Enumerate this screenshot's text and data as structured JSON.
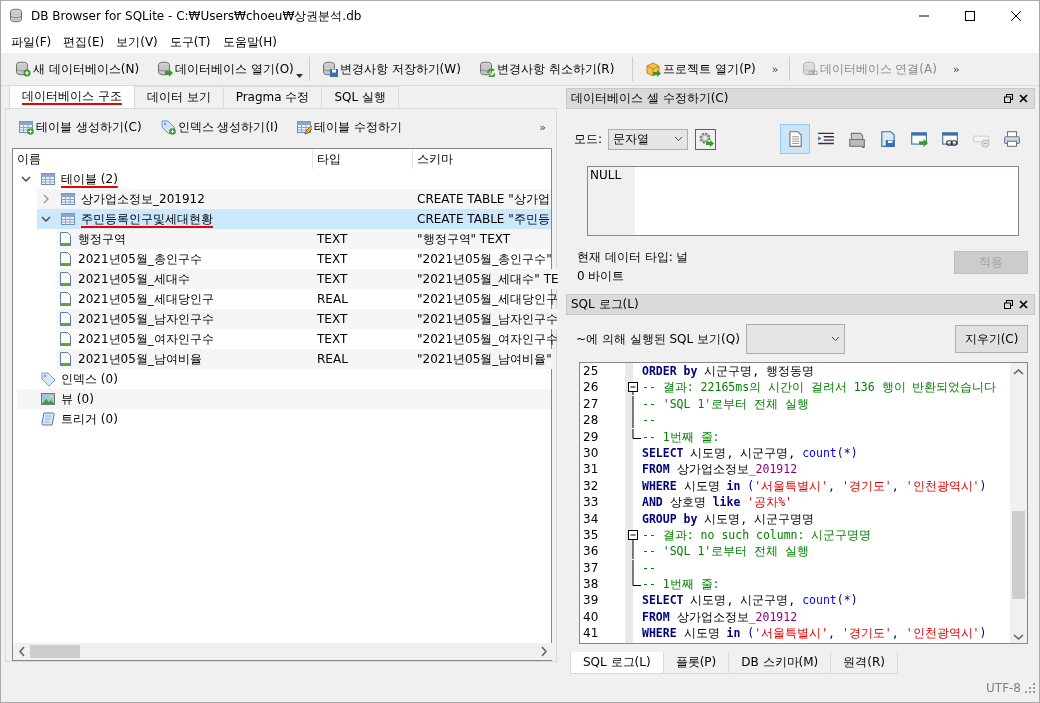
{
  "window": {
    "title": "DB Browser for SQLite - C:₩Users₩choeu₩상권분석.db"
  },
  "menu": [
    "파일(F)",
    "편집(E)",
    "보기(V)",
    "도구(T)",
    "도움말(H)"
  ],
  "toolbar": [
    {
      "kind": "button",
      "label": "새 데이터베이스(N)",
      "disabled": false
    },
    {
      "kind": "button",
      "label": "데이터베이스 열기(O)",
      "disabled": false,
      "dropdown": true
    },
    {
      "kind": "separator"
    },
    {
      "kind": "button",
      "label": "변경사항 저장하기(W)",
      "disabled": false
    },
    {
      "kind": "button",
      "label": "변경사항 취소하기(R)",
      "disabled": false
    },
    {
      "kind": "separator"
    },
    {
      "kind": "button",
      "label": "프로젝트 열기(P)",
      "disabled": false
    },
    {
      "kind": "overflow",
      "label": "»"
    },
    {
      "kind": "separator"
    },
    {
      "kind": "button",
      "label": "데이터베이스 연결(A)",
      "disabled": true
    },
    {
      "kind": "overflow",
      "label": "»"
    }
  ],
  "left_tabs": [
    {
      "label": "데이터베이스 구조",
      "selected": true,
      "underlined": true
    },
    {
      "label": "데이터 보기",
      "selected": false,
      "underlined": false
    },
    {
      "label": "Pragma 수정",
      "selected": false,
      "underlined": false
    },
    {
      "label": "SQL 실행",
      "selected": false,
      "underlined": false
    }
  ],
  "structure_toolbar": [
    {
      "kind": "button",
      "label": "테이블 생성하기(C)"
    },
    {
      "kind": "button",
      "label": "인덱스 생성하기(I)"
    },
    {
      "kind": "button",
      "label": "테이블 수정하기"
    },
    {
      "kind": "overflow",
      "label": "»"
    }
  ],
  "tree": {
    "columns": [
      "이름",
      "타입",
      "스키마"
    ],
    "items": [
      {
        "name": "테이블 (2)",
        "expanded": true,
        "selected": false,
        "underlined": true,
        "children": [
          {
            "name": "상가업소정보_201912",
            "schema": "CREATE TABLE \"상가업",
            "expanded": false,
            "selected": false,
            "underlined": false
          },
          {
            "name": "주민등록인구및세대현황",
            "schema": "CREATE TABLE \"주민등",
            "expanded": true,
            "selected": true,
            "underlined": true,
            "children": [
              {
                "name": "행정구역",
                "type": "TEXT",
                "schema": "\"행정구역\" TEXT",
                "selected": false,
                "underlined": false
              },
              {
                "name": "2021년05월_총인구수",
                "type": "TEXT",
                "schema": "\"2021년05월_총인구수\"",
                "selected": false,
                "underlined": false
              },
              {
                "name": "2021년05월_세대수",
                "type": "TEXT",
                "schema": "\"2021년05월_세대수\" TE",
                "selected": false,
                "underlined": false
              },
              {
                "name": "2021년05월_세대당인구",
                "type": "REAL",
                "schema": "\"2021년05월_세대당인구",
                "selected": false,
                "underlined": false
              },
              {
                "name": "2021년05월_남자인구수",
                "type": "TEXT",
                "schema": "\"2021년05월_남자인구수",
                "selected": false,
                "underlined": false
              },
              {
                "name": "2021년05월_여자인구수",
                "type": "TEXT",
                "schema": "\"2021년05월_여자인구수",
                "selected": false,
                "underlined": false
              },
              {
                "name": "2021년05월_남여비율",
                "type": "REAL",
                "schema": "\"2021년05월_남여비율\"",
                "selected": false,
                "underlined": false
              }
            ]
          }
        ]
      },
      {
        "name": "인덱스 (0)",
        "selected": false,
        "underlined": false
      },
      {
        "name": "뷰 (0)",
        "selected": false,
        "underlined": false
      },
      {
        "name": "트리거 (0)",
        "selected": false,
        "underlined": false
      }
    ]
  },
  "cell_editor": {
    "title": "데이터베이스 셀 수정하기(C)",
    "mode_label": "모드:",
    "mode": "문자열",
    "tools": [
      {
        "selected": true,
        "disabled": false
      },
      {
        "selected": false,
        "disabled": false
      },
      {
        "selected": false,
        "disabled": false
      },
      {
        "selected": false,
        "disabled": false
      },
      {
        "selected": false,
        "disabled": false
      },
      {
        "selected": false,
        "disabled": false
      },
      {
        "selected": false,
        "disabled": true
      },
      {
        "selected": false,
        "disabled": false
      }
    ],
    "value": "NULL",
    "type_info": "현재 데이터 타입: 널",
    "size": "0 바이트",
    "apply": {
      "label": "적용",
      "disabled": true
    }
  },
  "sql_log": {
    "title": "SQL 로그(L)",
    "filter_label": "~에 의해 실행된 SQL 보기(Q)",
    "clear": "지우기(C)",
    "lines": [
      {
        "no": "25",
        "kind": "code",
        "tokens": [
          {
            "kind": "kw",
            "text": "ORDER by"
          },
          {
            "kind": "plain",
            "text": " 시군구명, 행정동명"
          }
        ]
      },
      {
        "no": "26",
        "kind": "fold_start",
        "tokens": [
          {
            "kind": "cmt",
            "text": "-- 결과: 22165ms의 시간이 걸려서 136 행이 반환되었습니다"
          }
        ]
      },
      {
        "no": "27",
        "kind": "fold_body",
        "tokens": [
          {
            "kind": "cmt",
            "text": "-- 'SQL 1'로부터 전체 실행"
          }
        ]
      },
      {
        "no": "28",
        "kind": "fold_body",
        "tokens": [
          {
            "kind": "cmt",
            "text": "--"
          }
        ]
      },
      {
        "no": "29",
        "kind": "fold_end",
        "tokens": [
          {
            "kind": "cmt",
            "text": "-- 1번째 줄:"
          }
        ]
      },
      {
        "no": "30",
        "kind": "code",
        "tokens": [
          {
            "kind": "kw",
            "text": "SELECT"
          },
          {
            "kind": "plain",
            "text": " 시도명, 시군구명, "
          },
          {
            "kind": "fn",
            "text": "count"
          },
          {
            "kind": "op",
            "text": "(*)"
          }
        ]
      },
      {
        "no": "31",
        "kind": "code",
        "tokens": [
          {
            "kind": "kw",
            "text": "FROM"
          },
          {
            "kind": "plain",
            "text": " 상가업소정보"
          },
          {
            "kind": "num",
            "text": "_201912"
          }
        ]
      },
      {
        "no": "32",
        "kind": "code",
        "tokens": [
          {
            "kind": "kw",
            "text": "WHERE"
          },
          {
            "kind": "plain",
            "text": " 시도명 "
          },
          {
            "kind": "kw",
            "text": "in"
          },
          {
            "kind": "op",
            "text": " ("
          },
          {
            "kind": "str",
            "text": "'서울특별시'"
          },
          {
            "kind": "op",
            "text": ", "
          },
          {
            "kind": "str",
            "text": "'경기도'"
          },
          {
            "kind": "op",
            "text": ", "
          },
          {
            "kind": "str",
            "text": "'인천광역시'"
          },
          {
            "kind": "op",
            "text": ")"
          }
        ]
      },
      {
        "no": "33",
        "kind": "code",
        "tokens": [
          {
            "kind": "kw",
            "text": "AND"
          },
          {
            "kind": "plain",
            "text": " 상호명 "
          },
          {
            "kind": "kw",
            "text": "like "
          },
          {
            "kind": "str",
            "text": "'공차%'"
          }
        ]
      },
      {
        "no": "34",
        "kind": "code",
        "tokens": [
          {
            "kind": "kw",
            "text": "GROUP by"
          },
          {
            "kind": "plain",
            "text": " 시도명, 시군구명명"
          }
        ]
      },
      {
        "no": "35",
        "kind": "fold_start",
        "tokens": [
          {
            "kind": "cmt",
            "text": "-- 결과: no such column: 시군구명명"
          }
        ]
      },
      {
        "no": "36",
        "kind": "fold_body",
        "tokens": [
          {
            "kind": "cmt",
            "text": "-- 'SQL 1'로부터 전체 실행"
          }
        ]
      },
      {
        "no": "37",
        "kind": "fold_body",
        "tokens": [
          {
            "kind": "cmt",
            "text": "--"
          }
        ]
      },
      {
        "no": "38",
        "kind": "fold_end",
        "tokens": [
          {
            "kind": "cmt",
            "text": "-- 1번째 줄:"
          }
        ]
      },
      {
        "no": "39",
        "kind": "code",
        "tokens": [
          {
            "kind": "kw",
            "text": "SELECT"
          },
          {
            "kind": "plain",
            "text": " 시도명, 시군구명, "
          },
          {
            "kind": "fn",
            "text": "count"
          },
          {
            "kind": "op",
            "text": "(*)"
          }
        ]
      },
      {
        "no": "40",
        "kind": "code",
        "tokens": [
          {
            "kind": "kw",
            "text": "FROM"
          },
          {
            "kind": "plain",
            "text": " 상가업소정보"
          },
          {
            "kind": "num",
            "text": "_201912"
          }
        ]
      },
      {
        "no": "41",
        "kind": "code",
        "tokens": [
          {
            "kind": "kw",
            "text": "WHERE"
          },
          {
            "kind": "plain",
            "text": " 시도명 "
          },
          {
            "kind": "kw",
            "text": "in"
          },
          {
            "kind": "op",
            "text": " ("
          },
          {
            "kind": "str",
            "text": "'서울특별시'"
          },
          {
            "kind": "op",
            "text": ", "
          },
          {
            "kind": "str",
            "text": "'경기도'"
          },
          {
            "kind": "op",
            "text": ", "
          },
          {
            "kind": "str",
            "text": "'인천광역시'"
          },
          {
            "kind": "op",
            "text": ")"
          }
        ]
      }
    ]
  },
  "bottom_tabs": [
    {
      "label": "SQL 로그(L)",
      "selected": true
    },
    {
      "label": "플롯(P)",
      "selected": false
    },
    {
      "label": "DB 스키마(M)",
      "selected": false
    },
    {
      "label": "원격(R)",
      "selected": false
    }
  ],
  "status_bar": {
    "encoding": "UTF-8"
  }
}
